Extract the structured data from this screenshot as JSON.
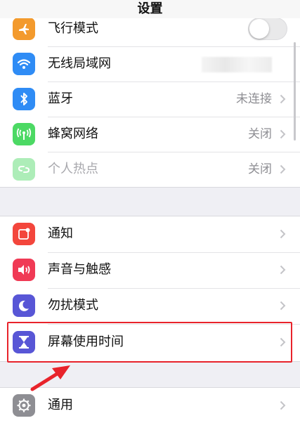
{
  "nav": {
    "title": "设置"
  },
  "group1": {
    "items": [
      {
        "label": "飞行模式",
        "icon": "airplane-icon",
        "color": "#f39a2d",
        "control": "toggle",
        "toggle_on": false
      },
      {
        "label": "无线局域网",
        "icon": "wifi-icon",
        "color": "#2f8cf5",
        "control": "blurred-value"
      },
      {
        "label": "蓝牙",
        "icon": "bluetooth-icon",
        "color": "#2f8cf5",
        "value": "未连接"
      },
      {
        "label": "蜂窝网络",
        "icon": "cellular-icon",
        "color": "#4cd964",
        "value": "关闭"
      },
      {
        "label": "个人热点",
        "icon": "hotspot-icon",
        "color": "#4cd964",
        "value": "关闭",
        "dimmed": true
      }
    ]
  },
  "group2": {
    "items": [
      {
        "label": "通知",
        "icon": "notifications-icon",
        "color": "#f3463c"
      },
      {
        "label": "声音与触感",
        "icon": "sounds-icon",
        "color": "#f03a55"
      },
      {
        "label": "勿扰模式",
        "icon": "moon-icon",
        "color": "#5856d6"
      },
      {
        "label": "屏幕使用时间",
        "icon": "hourglass-icon",
        "color": "#5856d6"
      }
    ]
  },
  "group3": {
    "items": [
      {
        "label": "通用",
        "icon": "gear-icon",
        "color": "#8e8e93"
      }
    ]
  },
  "colors": {
    "highlight": "#e8232b",
    "background": "#efeff4"
  }
}
